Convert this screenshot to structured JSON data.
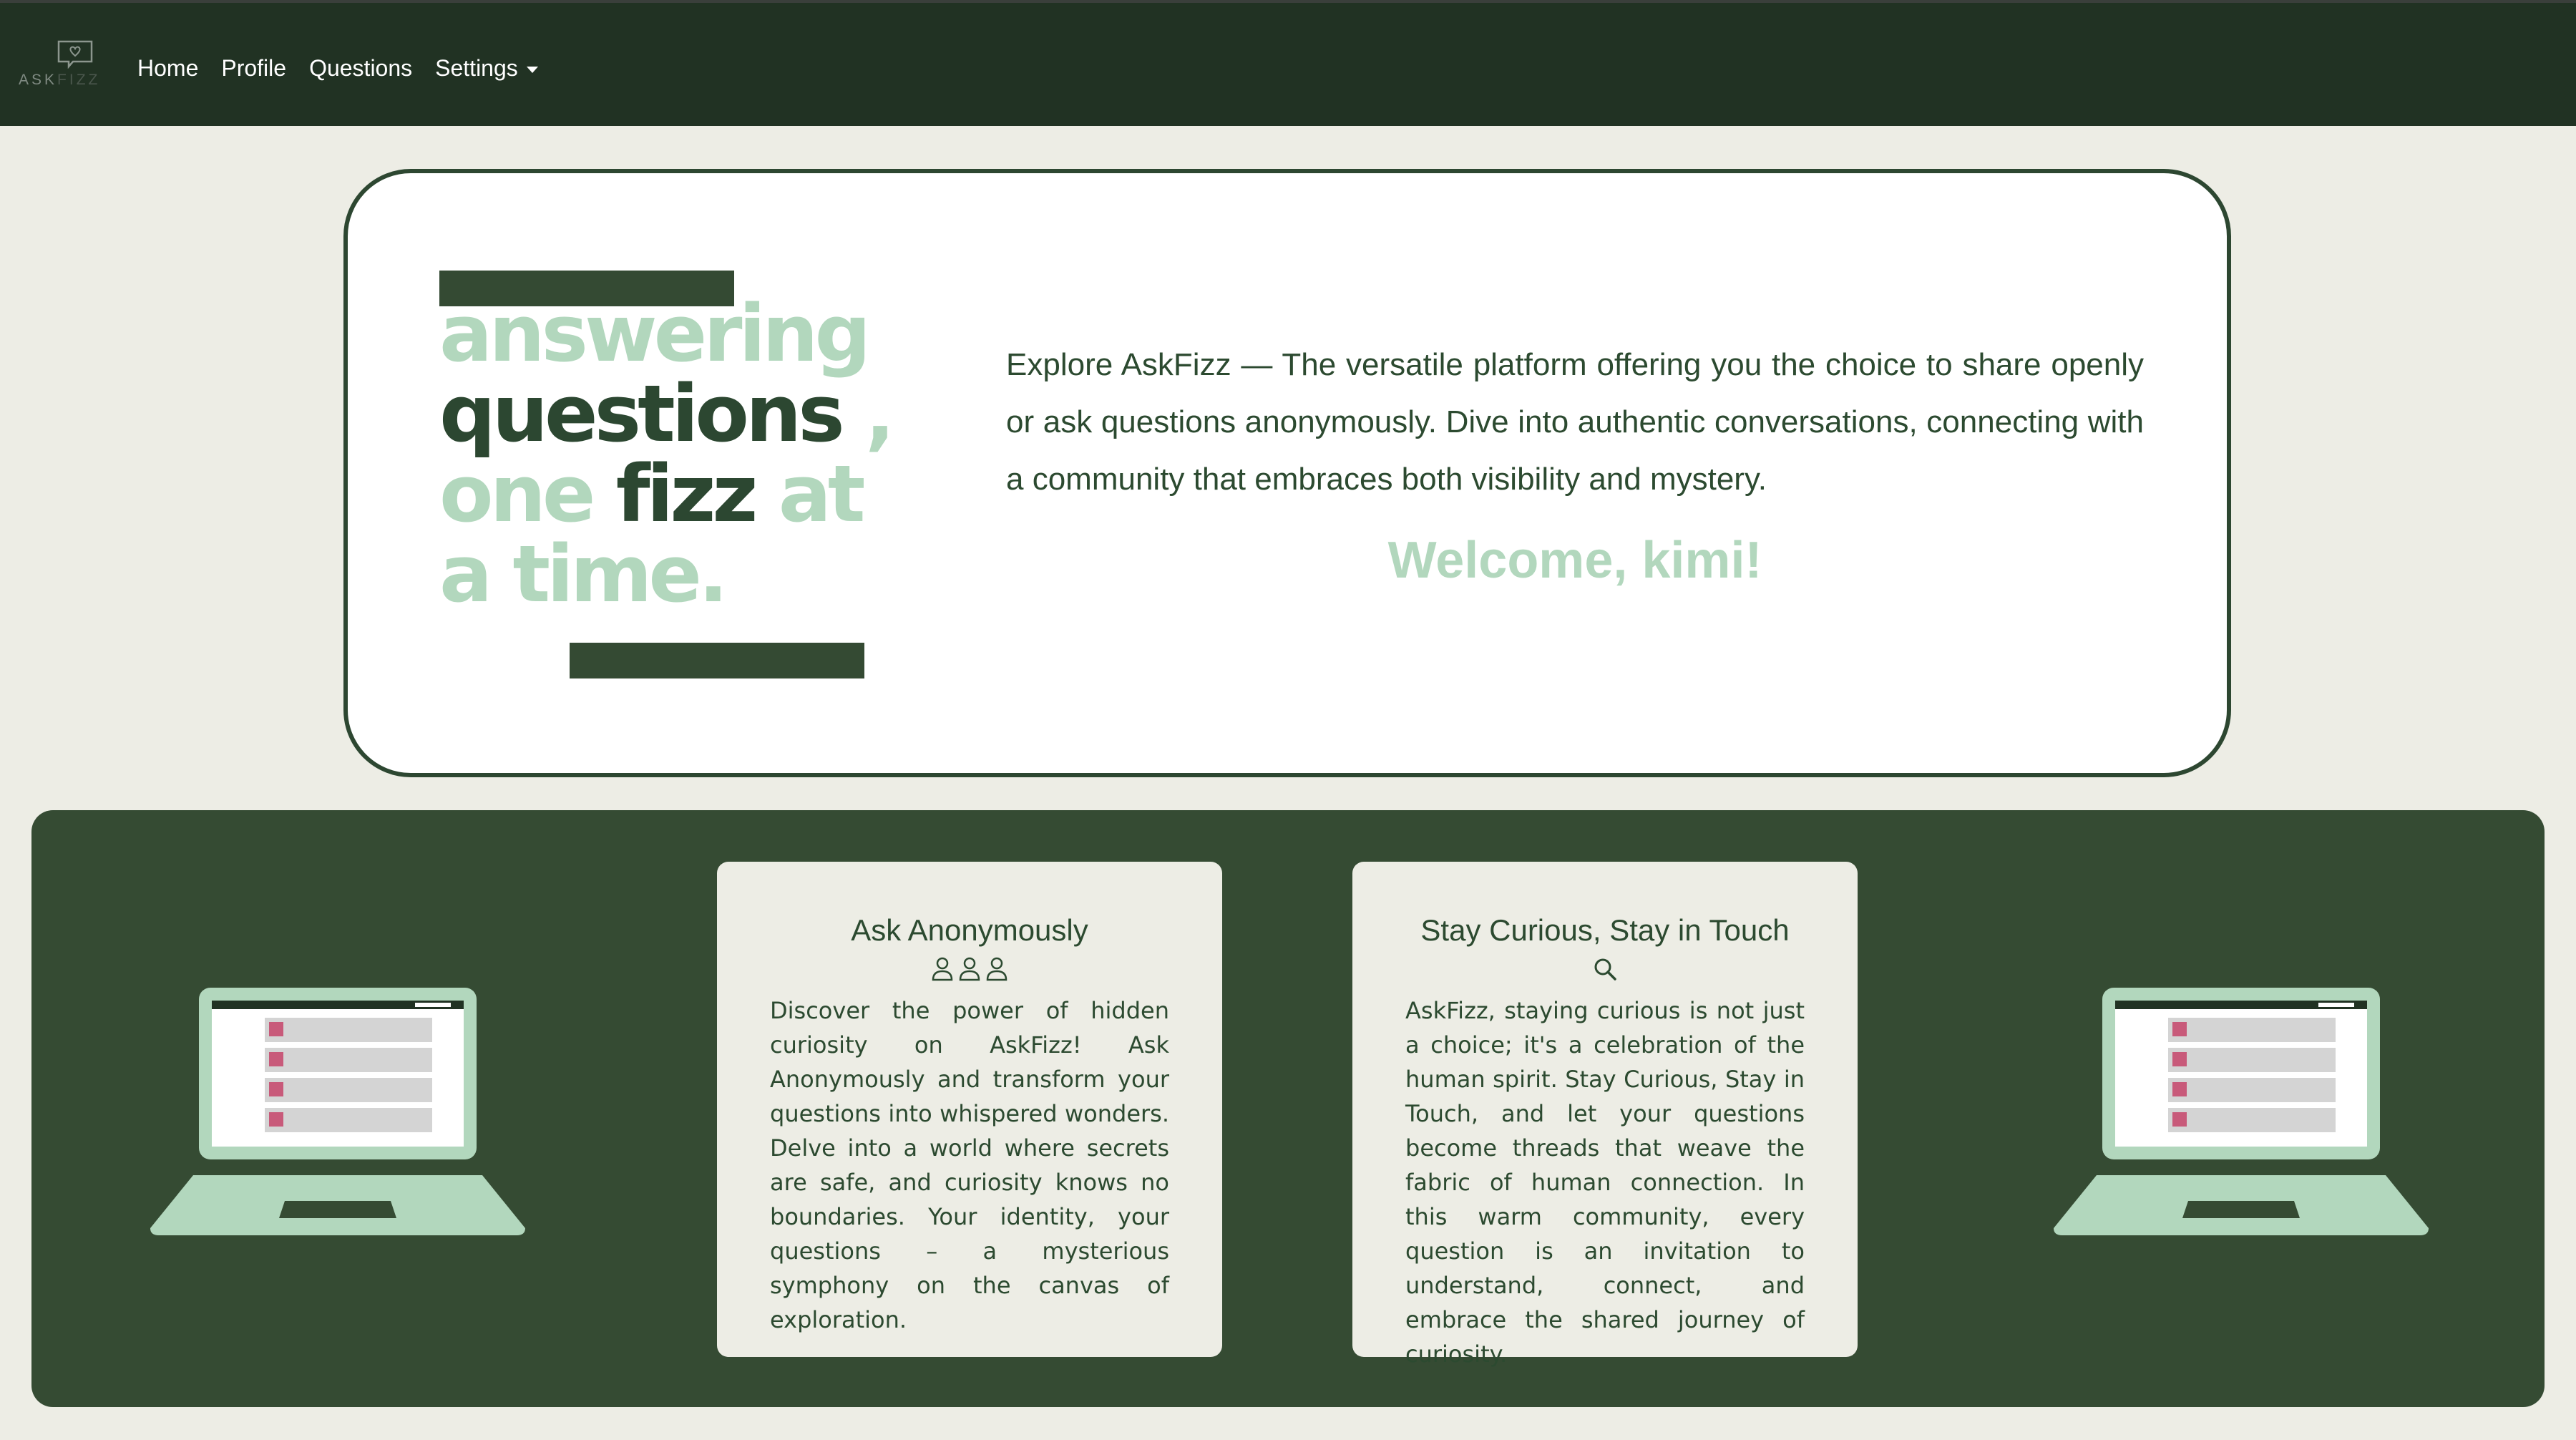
{
  "logo": {
    "text_ask": "ASK",
    "text_fizz": "FIZZ"
  },
  "nav": {
    "items": [
      "Home",
      "Profile",
      "Questions"
    ],
    "settings_label": "Settings"
  },
  "hero": {
    "tagline": {
      "line1": "answering",
      "line2_a": "questions",
      "line2_b": ",",
      "line3_a": "one",
      "line3_b": "fizz",
      "line3_c": "at",
      "line4": "a time."
    },
    "description": "Explore AskFizz — The versatile platform offering you the choice to share openly or ask questions anonymously. Dive into authentic conversations, connecting with a community that embraces both visibility and mystery.",
    "welcome": "Welcome, kimi!"
  },
  "features": {
    "cards": [
      {
        "title": "Ask Anonymously",
        "icon": "users-icon",
        "text": "Discover the power of hidden curiosity on AskFizz! Ask Anonymously and transform your questions into whispered wonders. Delve into a world where secrets are safe, and curiosity knows no boundaries. Your identity, your questions – a mysterious symphony on the canvas of exploration."
      },
      {
        "title": "Stay Curious, Stay in Touch",
        "icon": "search-icon",
        "text": "AskFizz, staying curious is not just a choice; it's a celebration of the human spirit. Stay Curious, Stay in Touch, and let your questions become threads that weave the fabric of human connection. In this warm community, every question is an invitation to understand, connect, and embrace the shared journey of curiosity."
      }
    ]
  },
  "colors": {
    "navbar": "#213223",
    "dark_green": "#354b33",
    "light_green": "#b2d7bd",
    "cream": "#edede5"
  }
}
